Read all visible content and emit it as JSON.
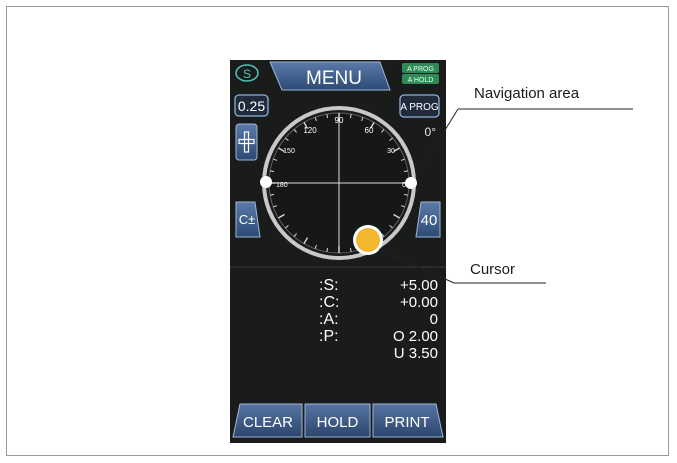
{
  "header": {
    "s_badge": "S",
    "menu_label": "MENU",
    "aprog_badge": "A PROG",
    "ahold_badge": "A HOLD"
  },
  "controls": {
    "step_value": "0.25",
    "aprog_button": "A PROG",
    "c_sign_button": "C±",
    "right_value": "40"
  },
  "dial": {
    "zero_label": "0°",
    "angles": [
      "120",
      "90",
      "60",
      "150",
      "30",
      "180",
      "0"
    ]
  },
  "readout": {
    "rows": [
      {
        "key": ":S:",
        "value": "+5.00"
      },
      {
        "key": ":C:",
        "value": "+0.00"
      },
      {
        "key": ":A:",
        "value": "0"
      },
      {
        "key": ":P:",
        "value": "O  2.00"
      },
      {
        "key": "",
        "value": "U  3.50"
      }
    ]
  },
  "bottom_bar": {
    "clear": "CLEAR",
    "hold": "HOLD",
    "print": "PRINT"
  },
  "callouts": {
    "navigation": "Navigation area",
    "cursor": "Cursor"
  },
  "colors": {
    "screen_bg": "#1a1c1c",
    "button_blue": "#3a5a86",
    "badge_green": "#2e8b57",
    "cursor_yellow": "#f2b630"
  }
}
